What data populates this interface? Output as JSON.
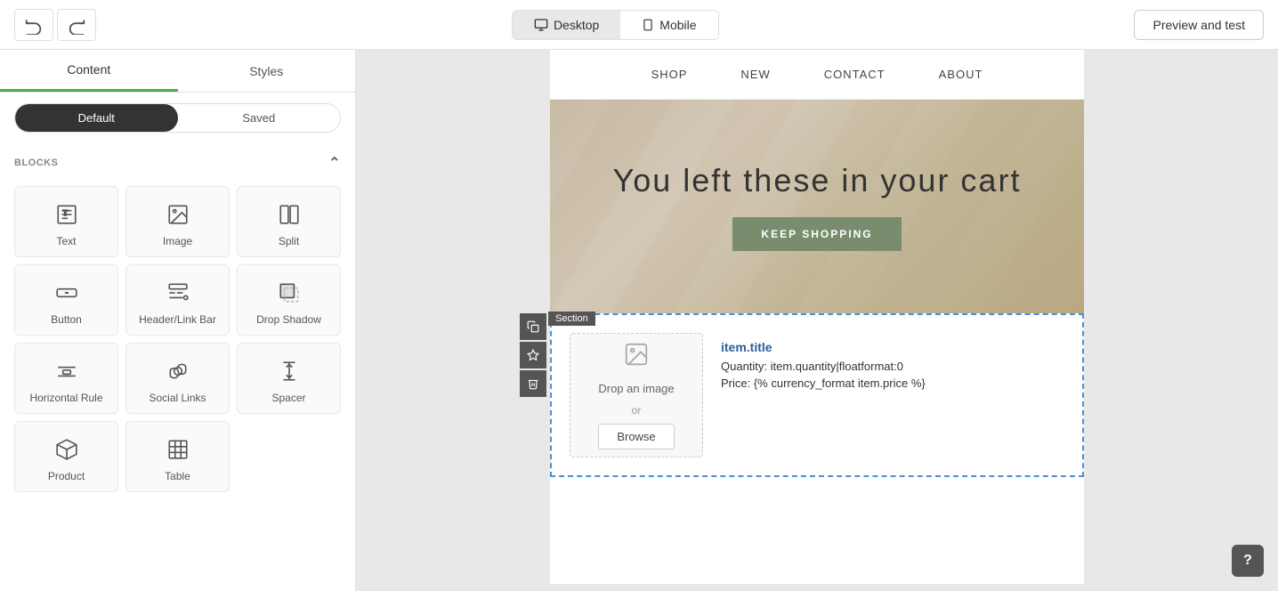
{
  "toolbar": {
    "undo_title": "Undo",
    "redo_title": "Redo",
    "desktop_label": "Desktop",
    "mobile_label": "Mobile",
    "preview_label": "Preview and test"
  },
  "sidebar": {
    "tab_content": "Content",
    "tab_styles": "Styles",
    "state_default": "Default",
    "state_saved": "Saved",
    "blocks_header": "BLOCKS",
    "blocks": [
      {
        "id": "text",
        "label": "Text",
        "icon": "T"
      },
      {
        "id": "image",
        "label": "Image",
        "icon": "IMG"
      },
      {
        "id": "split",
        "label": "Split",
        "icon": "SPLIT"
      },
      {
        "id": "button",
        "label": "Button",
        "icon": "BTN"
      },
      {
        "id": "header-link-bar",
        "label": "Header/Link Bar",
        "icon": "HDR"
      },
      {
        "id": "drop-shadow",
        "label": "Drop Shadow",
        "icon": "SHD"
      },
      {
        "id": "horizontal-rule",
        "label": "Horizontal Rule",
        "icon": "HR"
      },
      {
        "id": "social-links",
        "label": "Social Links",
        "icon": "SOC"
      },
      {
        "id": "spacer",
        "label": "Spacer",
        "icon": "SPC"
      },
      {
        "id": "product",
        "label": "Product",
        "icon": "PRD"
      },
      {
        "id": "table",
        "label": "Table",
        "icon": "TBL"
      }
    ]
  },
  "email_preview": {
    "nav_items": [
      "SHOP",
      "NEW",
      "CONTACT",
      "ABOUT"
    ],
    "hero_title": "You left these in your cart",
    "hero_button": "KEEP SHOPPING",
    "section_label": "Section",
    "product": {
      "drop_text": "Drop an image",
      "drop_or": "or",
      "browse_label": "Browse",
      "title": "item.title",
      "quantity_label": "Quantity: item.quantity|floatformat:0",
      "price_label": "Price: {% currency_format item.price %}"
    }
  },
  "help_button": "?"
}
